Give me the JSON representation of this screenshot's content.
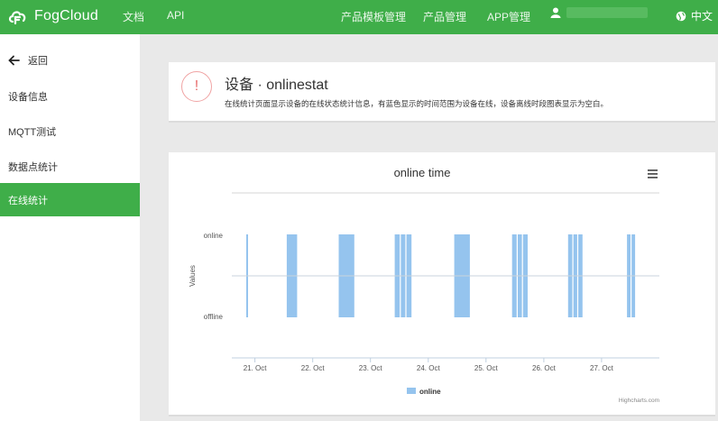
{
  "header": {
    "brand": "FogCloud",
    "nav": [
      "文档",
      "API"
    ],
    "right_nav": [
      "产品模板管理",
      "产品管理",
      "APP管理"
    ],
    "lang": "中文",
    "colors": {
      "bar": "#3fae49",
      "accent": "#3fae49"
    },
    "icons": {
      "logo": "cloud-logo-icon",
      "user": "user-icon",
      "lang": "globe-icon"
    }
  },
  "sidebar": {
    "back": "返回",
    "items": [
      "设备信息",
      "MQTT测试",
      "数据点统计",
      "在线统计"
    ],
    "active": "在线统计"
  },
  "notice": {
    "title": "设备 · onlinestat",
    "description": "在线统计页面显示设备的在线状态统计信息，有蓝色显示的时间范围为设备在线，设备离线时段图表显示为空白。"
  },
  "chart_data": {
    "type": "area",
    "title": "online time",
    "ylabel": "Values",
    "y_categories": [
      "offline",
      "online"
    ],
    "x_ticks": [
      "21. Oct",
      "22. Oct",
      "23. Oct",
      "24. Oct",
      "25. Oct",
      "26. Oct",
      "27. Oct"
    ],
    "series": [
      {
        "name": "online",
        "color": "#95c4ee",
        "online_ranges_day": [
          [
            20.85,
            20.87
          ],
          [
            21.55,
            21.73
          ],
          [
            22.45,
            22.72
          ],
          [
            23.42,
            23.71
          ],
          [
            24.45,
            24.72
          ],
          [
            25.45,
            25.72
          ],
          [
            26.42,
            26.67
          ],
          [
            27.44,
            27.58
          ]
        ]
      }
    ],
    "x_range_day": [
      20.6,
      28.0
    ],
    "credits": "Highcharts.com",
    "menu_icon": "hamburger-menu-icon"
  }
}
